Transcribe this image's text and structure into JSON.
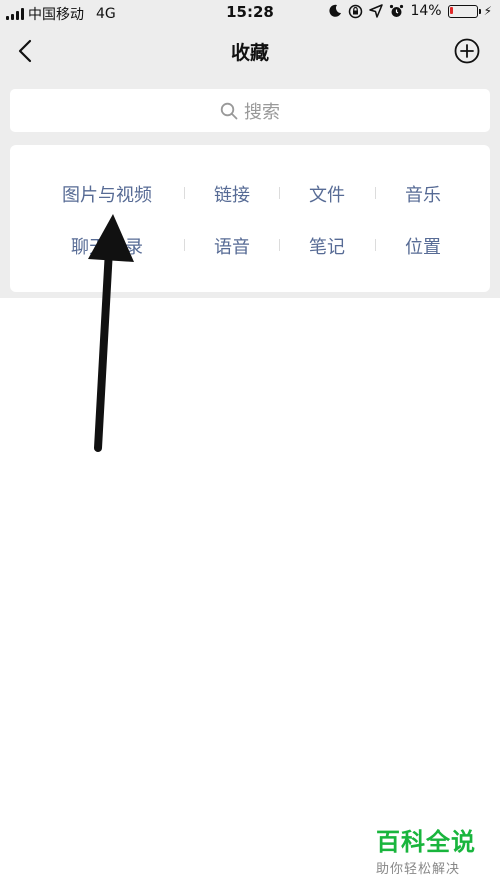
{
  "status_bar": {
    "carrier": "中国移动",
    "network": "4G",
    "time": "15:28",
    "battery_percent_label": "14%",
    "battery_level": 0.14
  },
  "nav": {
    "title": "收藏",
    "back_icon": "chevron-left-icon",
    "add_icon": "circle-plus-icon"
  },
  "search": {
    "placeholder": "搜索",
    "icon": "search-icon"
  },
  "categories": {
    "row1": [
      "图片与视频",
      "链接",
      "文件",
      "音乐"
    ],
    "row2": [
      "聊天记录",
      "语音",
      "笔记",
      "位置"
    ]
  },
  "colors": {
    "link_blue": "#576b95",
    "battery_low": "#e02828",
    "watermark_green": "#19b53d"
  },
  "watermark": {
    "title": "百科全说",
    "subtitle": "助你轻松解决"
  }
}
